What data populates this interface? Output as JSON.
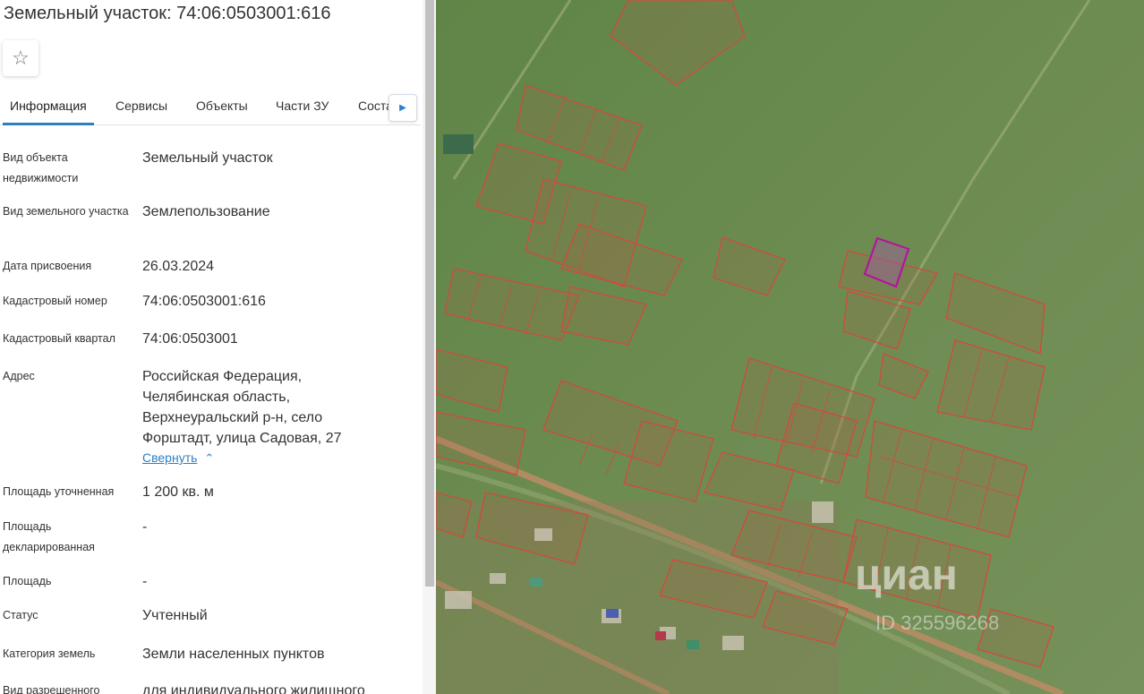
{
  "header": {
    "title": "Земельный участок: 74:06:0503001:616"
  },
  "tabs": [
    {
      "label": "Информация"
    },
    {
      "label": "Сервисы"
    },
    {
      "label": "Объекты"
    },
    {
      "label": "Части ЗУ"
    },
    {
      "label": "Соста"
    }
  ],
  "fields": [
    {
      "label": "Вид объекта недвижимости",
      "value": "Земельный участок"
    },
    {
      "label": "Вид земельного участка",
      "value": "Землепользование"
    },
    {
      "label": "Дата присвоения",
      "value": "26.03.2024"
    },
    {
      "label": "Кадастровый номер",
      "value": "74:06:0503001:616"
    },
    {
      "label": "Кадастровый квартал",
      "value": "74:06:0503001"
    },
    {
      "label": "Адрес",
      "value": "Российская Федерация, Челябинская область, Верхнеуральский р-н, село Форштадт, улица Садовая, 27"
    },
    {
      "label": "Площадь уточненная",
      "value": "1 200 кв. м"
    },
    {
      "label": "Площадь декларированная",
      "value": "-"
    },
    {
      "label": "Площадь",
      "value": "-"
    },
    {
      "label": "Статус",
      "value": "Учтенный"
    },
    {
      "label": "Категория земель",
      "value": "Земли населенных пунктов"
    },
    {
      "label": "Вид разрешенного",
      "value": "для индивидуального жилищного"
    }
  ],
  "address_toggle": "Свернуть",
  "map": {
    "watermark": "циан",
    "watermark_id": "ID 325596268",
    "colors": {
      "field": "#6f8c52",
      "parcel_stroke": "#d24a3a",
      "selected_stroke": "#b0179a",
      "road": "#a8845a"
    }
  }
}
